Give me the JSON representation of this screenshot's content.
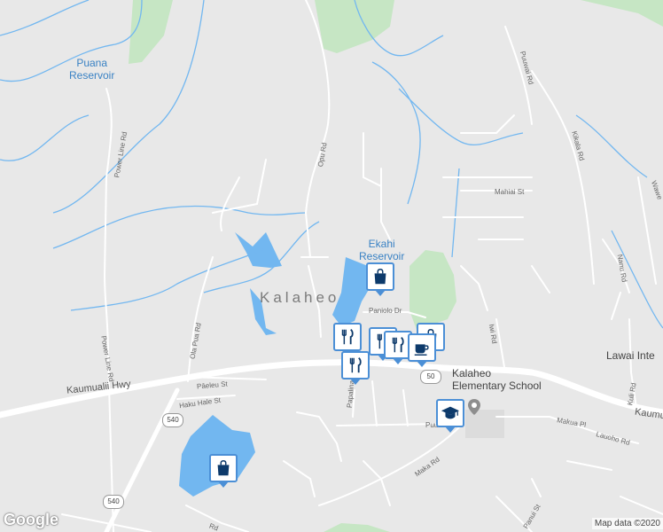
{
  "map": {
    "colors": {
      "land": "#e8e8e8",
      "water": "#72b7f0",
      "park": "#c6e6c4",
      "road": "#ffffff",
      "pin_border": "#4b8fd6",
      "pin_icon": "#0d3a6b"
    },
    "water_labels": {
      "puana": "Puana\nReservoir",
      "ekahi": "Ekahi\nReservoir"
    },
    "town_label": "Kalaheo",
    "highways": {
      "kaumualii_left": "Kaumualii Hwy",
      "kaumualii_right": "Kaumu"
    },
    "route_shields": {
      "r540_a": "540",
      "r540_b": "540",
      "r50": "50"
    },
    "roads": {
      "opu": "Opu Rd",
      "power_line_upper": "Power Line Rd",
      "power_line_lower": "Power Line Rd",
      "puuwai": "Puuwai Rd",
      "kikala": "Kikala Rd",
      "mahiai": "Mahiai St",
      "paniolo": "Paniolo Dr",
      "iwi": "Iwi Rd",
      "ola_pua": "Ola Pua Rd",
      "paeleu": "Pāeleu St",
      "haku_hale": "Haku Hale St",
      "papalina": "Papalina",
      "puu": "Puu Rd",
      "maka": "Maka Rd",
      "makua": "Makua Pl",
      "lauoho": "Lauoho Rd",
      "kuli": "Kuli Rd",
      "nanu": "Nanu Rd",
      "wawe": "Wawe",
      "panui": "Panui St",
      "rd_bottom": "Rd"
    },
    "places": {
      "school": "Kalaheo\nElementary School",
      "lawai": "Lawai Inte"
    },
    "pins": [
      {
        "type": "shopping",
        "icon": "shopping-bag-icon"
      },
      {
        "type": "restaurant",
        "icon": "fork-knife-icon"
      },
      {
        "type": "restaurant",
        "icon": "fork-knife-icon"
      },
      {
        "type": "restaurant",
        "icon": "fork-knife-icon"
      },
      {
        "type": "shopping",
        "icon": "shopping-bag-icon"
      },
      {
        "type": "cafe",
        "icon": "coffee-cup-icon"
      },
      {
        "type": "restaurant",
        "icon": "fork-knife-icon"
      },
      {
        "type": "school",
        "icon": "graduation-cap-icon"
      },
      {
        "type": "shopping",
        "icon": "shopping-bag-icon"
      }
    ],
    "logo": "Google",
    "attribution": "Map data ©2020"
  }
}
